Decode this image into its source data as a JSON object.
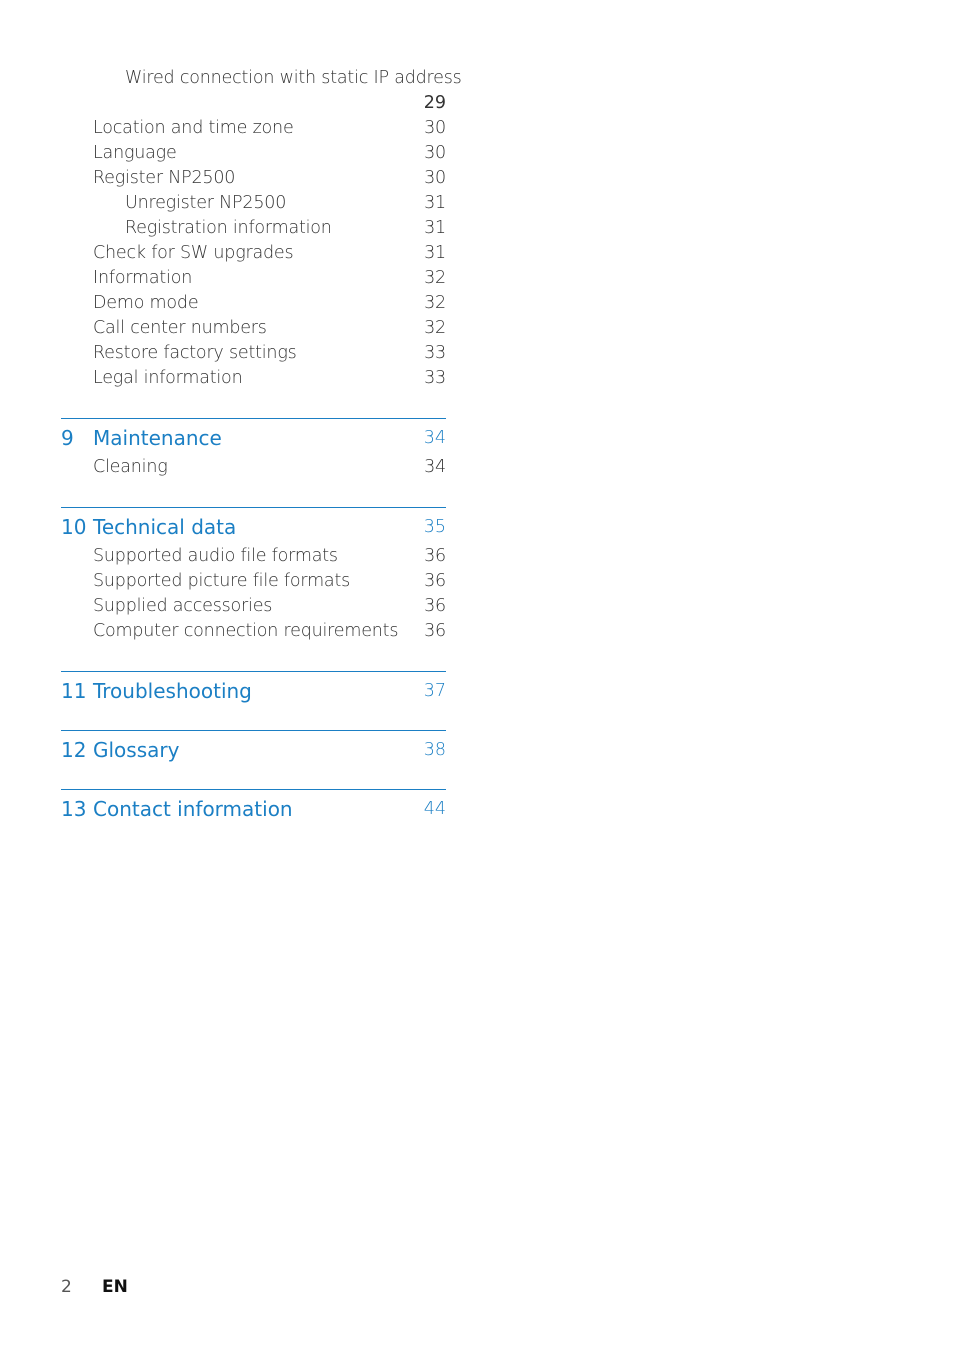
{
  "toc_continued": {
    "first_entry": {
      "label": "Wired connection with static IP address",
      "page": "29"
    },
    "entries": [
      {
        "label": "Location and time zone",
        "page": "30",
        "level": 1
      },
      {
        "label": "Language",
        "page": "30",
        "level": 1
      },
      {
        "label": "Register NP2500",
        "page": "30",
        "level": 1
      },
      {
        "label": "Unregister NP2500",
        "page": "31",
        "level": 2
      },
      {
        "label": "Registration information",
        "page": "31",
        "level": 2
      },
      {
        "label": "Check for SW upgrades",
        "page": "31",
        "level": 1
      },
      {
        "label": "Information",
        "page": "32",
        "level": 1
      },
      {
        "label": "Demo mode",
        "page": "32",
        "level": 1
      },
      {
        "label": "Call center numbers",
        "page": "32",
        "level": 1
      },
      {
        "label": "Restore factory settings",
        "page": "33",
        "level": 1
      },
      {
        "label": "Legal information",
        "page": "33",
        "level": 1
      }
    ]
  },
  "sections": [
    {
      "number": "9",
      "title": "Maintenance",
      "page": "34",
      "entries": [
        {
          "label": "Cleaning",
          "page": "34"
        }
      ]
    },
    {
      "number": "10",
      "title": "Technical data",
      "page": "35",
      "entries": [
        {
          "label": "Supported audio file formats",
          "page": "36"
        },
        {
          "label": "Supported picture file formats",
          "page": "36"
        },
        {
          "label": "Supplied accessories",
          "page": "36"
        },
        {
          "label": "Computer connection requirements",
          "page": "36"
        }
      ]
    },
    {
      "number": "11",
      "title": "Troubleshooting",
      "page": "37",
      "entries": []
    },
    {
      "number": "12",
      "title": "Glossary",
      "page": "38",
      "entries": []
    },
    {
      "number": "13",
      "title": "Contact information",
      "page": "44",
      "entries": []
    }
  ],
  "footer": {
    "page_number": "2",
    "language": "EN"
  },
  "colors": {
    "accent": "#1b7fc4",
    "text": "#333333"
  }
}
